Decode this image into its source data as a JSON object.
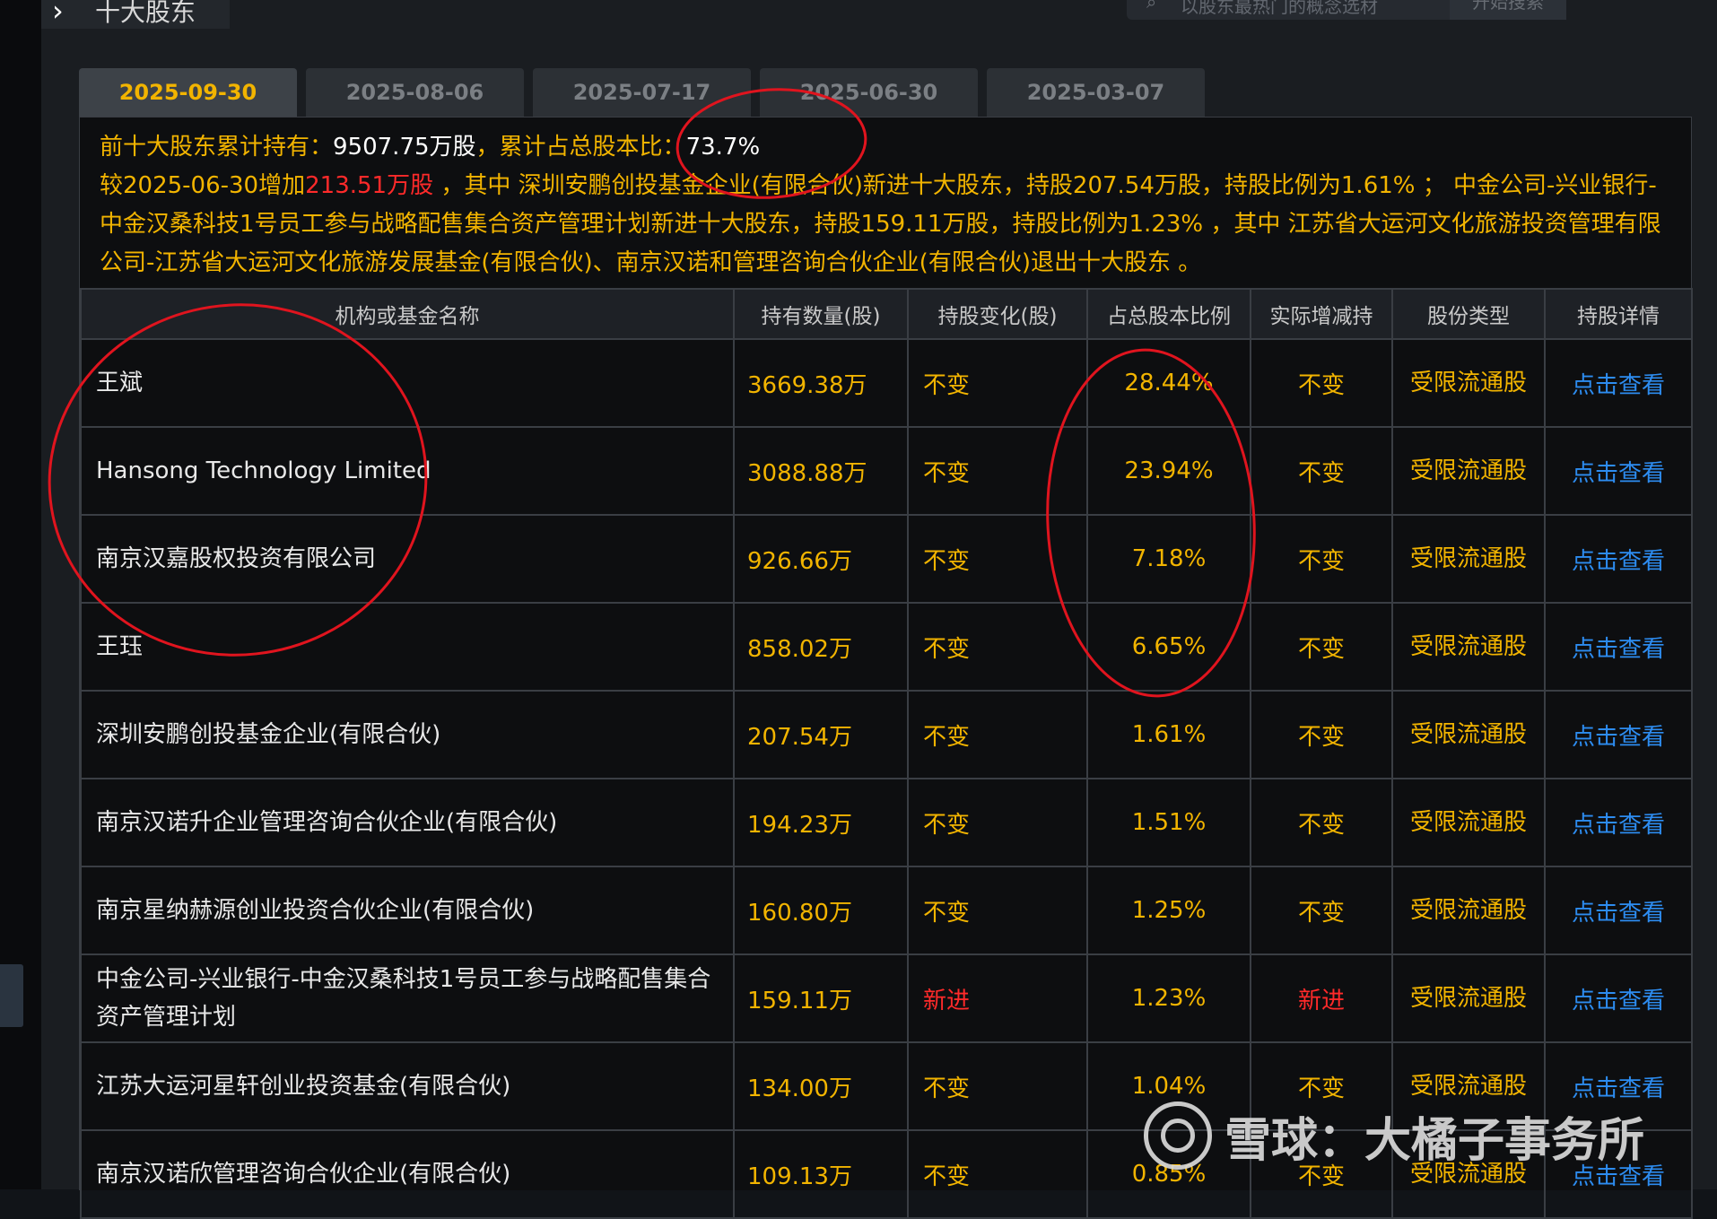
{
  "section": {
    "title": "十大股东"
  },
  "search": {
    "placeholder": "以股东最热门的概念选材",
    "button": "开始搜索"
  },
  "tabs": [
    {
      "label": "2025-09-30",
      "active": true
    },
    {
      "label": "2025-08-06",
      "active": false
    },
    {
      "label": "2025-07-17",
      "active": false
    },
    {
      "label": "2025-06-30",
      "active": false
    },
    {
      "label": "2025-03-07",
      "active": false
    }
  ],
  "summary": {
    "line1_prefix": "前十大股东累计持有：",
    "total_shares": "9507.75万股",
    "ratio_prefix": "，累计占总股本比：",
    "ratio": "73.7%",
    "compare_prefix": "较2025-06-30增加",
    "increase": "213.51万股",
    "detail": " ，其中 深圳安鹏创投基金企业(有限合伙)新进十大股东，持股207.54万股，持股比例为1.61% ； 中金公司-兴业银行-中金汉桑科技1号员工参与战略配售集合资产管理计划新进十大股东，持股159.11万股，持股比例为1.23% ，其中 江苏省大运河文化旅游投资管理有限公司-江苏省大运河文化旅游发展基金(有限合伙)、南京汉诺和管理咨询合伙企业(有限合伙)退出十大股东 。"
  },
  "table": {
    "headers": [
      "机构或基金名称",
      "持有数量(股)",
      "持股变化(股)",
      "占总股本比例",
      "实际增减持",
      "股份类型",
      "持股详情"
    ],
    "rows": [
      {
        "name": "王斌",
        "qty": "3669.38万",
        "change": "不变",
        "ratio": "28.44%",
        "actual": "不变",
        "type": "受限流通股",
        "detail": "点击查看"
      },
      {
        "name": "Hansong Technology Limited",
        "qty": "3088.88万",
        "change": "不变",
        "ratio": "23.94%",
        "actual": "不变",
        "type": "受限流通股",
        "detail": "点击查看"
      },
      {
        "name": "南京汉嘉股权投资有限公司",
        "qty": "926.66万",
        "change": "不变",
        "ratio": "7.18%",
        "actual": "不变",
        "type": "受限流通股",
        "detail": "点击查看"
      },
      {
        "name": "王珏",
        "qty": "858.02万",
        "change": "不变",
        "ratio": "6.65%",
        "actual": "不变",
        "type": "受限流通股",
        "detail": "点击查看"
      },
      {
        "name": "深圳安鹏创投基金企业(有限合伙)",
        "qty": "207.54万",
        "change": "不变",
        "ratio": "1.61%",
        "actual": "不变",
        "type": "受限流通股",
        "detail": "点击查看"
      },
      {
        "name": "南京汉诺升企业管理咨询合伙企业(有限合伙)",
        "qty": "194.23万",
        "change": "不变",
        "ratio": "1.51%",
        "actual": "不变",
        "type": "受限流通股",
        "detail": "点击查看"
      },
      {
        "name": "南京星纳赫源创业投资合伙企业(有限合伙)",
        "qty": "160.80万",
        "change": "不变",
        "ratio": "1.25%",
        "actual": "不变",
        "type": "受限流通股",
        "detail": "点击查看"
      },
      {
        "name": "中金公司-兴业银行-中金汉桑科技1号员工参与战略配售集合资产管理计划",
        "qty": "159.11万",
        "change": "新进",
        "ratio": "1.23%",
        "actual": "新进",
        "type": "受限流通股",
        "detail": "点击查看"
      },
      {
        "name": "江苏大运河星轩创业投资基金(有限合伙)",
        "qty": "134.00万",
        "change": "不变",
        "ratio": "1.04%",
        "actual": "不变",
        "type": "受限流通股",
        "detail": "点击查看"
      },
      {
        "name": "南京汉诺欣管理咨询合伙企业(有限合伙)",
        "qty": "109.13万",
        "change": "不变",
        "ratio": "0.85%",
        "actual": "不变",
        "type": "受限流通股",
        "detail": "点击查看"
      }
    ]
  },
  "watermark": {
    "text": "雪球：大橘子事务所"
  },
  "colors": {
    "accent": "#f2b400",
    "new_entry": "#ff2a2a",
    "link": "#2d8cf0",
    "annotation": "#e0141e"
  }
}
